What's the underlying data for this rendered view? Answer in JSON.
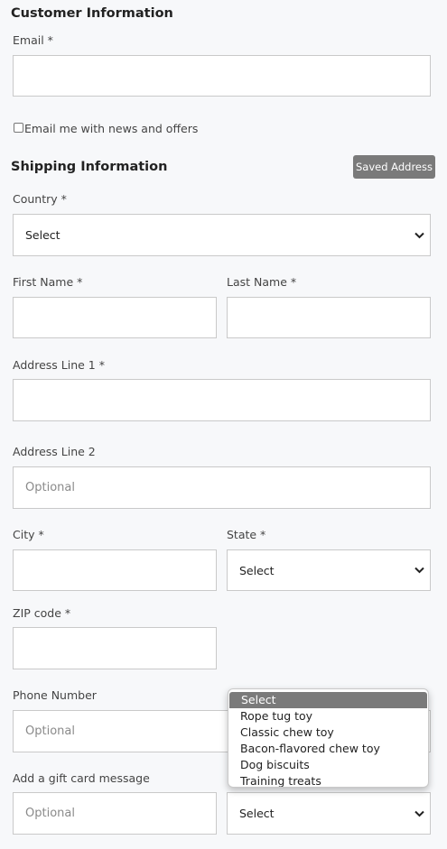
{
  "customer": {
    "title": "Customer Information",
    "email_label": "Email *",
    "newsletter_label": "Email me with news and offers"
  },
  "shipping": {
    "title": "Shipping Information",
    "saved_address_label": "Saved Address",
    "country_label": "Country *",
    "country_value": "Select",
    "first_name_label": "First Name *",
    "last_name_label": "Last Name *",
    "address1_label": "Address Line 1 *",
    "address2_label": "Address Line 2",
    "address2_placeholder": "Optional",
    "city_label": "City *",
    "state_label": "State *",
    "state_value": "Select",
    "zip_label": "ZIP code *",
    "phone_label": "Phone Number",
    "phone_placeholder": "Optional",
    "gift_label": "Add a gift card message",
    "gift_placeholder": "Optional",
    "gift_select_value": "Select"
  },
  "dropdown": {
    "options": [
      "Select",
      "Rope tug toy",
      "Classic chew toy",
      "Bacon-flavored chew toy",
      "Dog biscuits",
      "Training treats"
    ]
  },
  "colors": {
    "background": "#f7f8fa",
    "button": "#7a7a7a",
    "border": "#c9c9c9"
  }
}
